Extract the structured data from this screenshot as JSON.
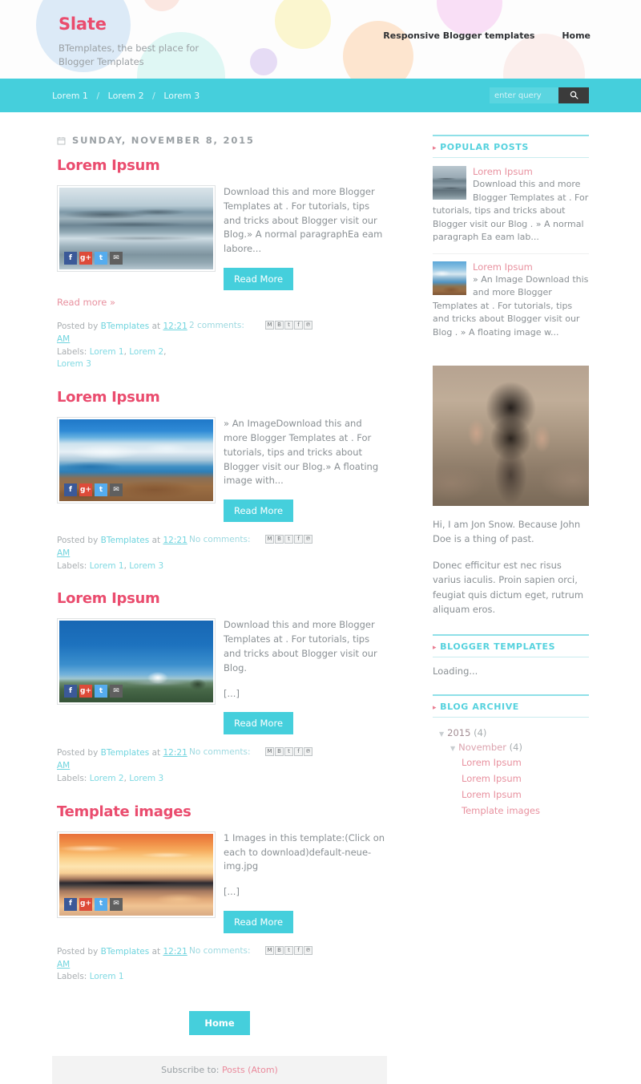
{
  "header": {
    "brand_title": "Slate",
    "brand_description": "BTemplates, the best place for Blogger Templates",
    "nav": [
      {
        "label": "Responsive Blogger templates"
      },
      {
        "label": "Home"
      }
    ]
  },
  "navbar": {
    "breadcrumb": [
      {
        "label": "Lorem 1"
      },
      {
        "label": "Lorem 2"
      },
      {
        "label": "Lorem 3"
      }
    ],
    "separator": "/",
    "search": {
      "placeholder": "enter query",
      "value": "",
      "button_icon": "search-icon"
    }
  },
  "main": {
    "date_header": "SUNDAY, NOVEMBER 8, 2015",
    "date_icon": "calendar-icon",
    "read_more_button": "Read More",
    "read_more_link": "Read more »",
    "share_buttons": [
      {
        "name": "facebook",
        "glyph": "f",
        "color": "#3b5998"
      },
      {
        "name": "google-plus",
        "glyph": "g+",
        "color": "#dd4b39"
      },
      {
        "name": "twitter",
        "glyph": "t",
        "color": "#55acee"
      },
      {
        "name": "email",
        "glyph": "✉",
        "color": "#5f5f5f"
      }
    ],
    "meta_share_icons": [
      {
        "name": "email-post-icon",
        "glyph": "M"
      },
      {
        "name": "blog-this-icon",
        "glyph": "B"
      },
      {
        "name": "share-to-twitter-icon",
        "glyph": "t"
      },
      {
        "name": "share-to-facebook-icon",
        "glyph": "f"
      },
      {
        "name": "share-to-pinterest-icon",
        "glyph": "℗"
      }
    ],
    "posts": [
      {
        "title": "Lorem Ipsum",
        "image": "img-snow",
        "excerpt": "Download this and more Blogger Templates at . For tutorials, tips and tricks about Blogger visit our Blog.» A normal paragraphEa eam labore...",
        "extra": "",
        "has_read_more_link": true,
        "posted_by_prefix": "Posted by",
        "author": "BTemplates",
        "at": "at",
        "time": "12:21 AM",
        "comments": "2 comments:",
        "labels_prefix": "Labels:",
        "labels": [
          "Lorem 1",
          "Lorem 2",
          "Lorem 3"
        ]
      },
      {
        "title": "Lorem Ipsum",
        "image": "img-glacier",
        "excerpt": "» An ImageDownload this and more Blogger Templates at . For tutorials, tips and tricks about Blogger visit our Blog.» A floating image with...",
        "extra": "",
        "has_read_more_link": false,
        "posted_by_prefix": "Posted by",
        "author": "BTemplates",
        "at": "at",
        "time": "12:21 AM",
        "comments": "No comments:",
        "labels_prefix": "Labels:",
        "labels": [
          "Lorem 1",
          "Lorem 3"
        ]
      },
      {
        "title": "Lorem Ipsum",
        "image": "img-volcano",
        "excerpt": "Download this and more Blogger Templates at . For tutorials, tips and tricks about Blogger visit our Blog.",
        "extra": "[...]",
        "has_read_more_link": false,
        "posted_by_prefix": "Posted by",
        "author": "BTemplates",
        "at": "at",
        "time": "12:21 AM",
        "comments": "No comments:",
        "labels_prefix": "Labels:",
        "labels": [
          "Lorem 2",
          "Lorem 3"
        ]
      },
      {
        "title": "Template images",
        "image": "img-sunset",
        "excerpt": "1 Images in this template:(Click on each to download)default-neue-img.jpg",
        "extra": "[...]",
        "has_read_more_link": false,
        "posted_by_prefix": "Posted by",
        "author": "BTemplates",
        "at": "at",
        "time": "12:21 AM",
        "comments": "No comments:",
        "labels_prefix": "Labels:",
        "labels": [
          "Lorem 1"
        ]
      }
    ],
    "home_button": "Home",
    "subscribe_prefix": "Subscribe to:",
    "subscribe_link": "Posts (Atom)"
  },
  "sidebar": {
    "popular_posts": {
      "title": "POPULAR POSTS",
      "items": [
        {
          "title": "Lorem Ipsum",
          "image": "img-birds",
          "snippet": "Download this and more Blogger Templates at . For tutorials, tips and tricks about Blogger visit our Blog . » A normal paragraph Ea eam lab..."
        },
        {
          "title": "Lorem Ipsum",
          "image": "img-glacier-sm",
          "snippet": "» An Image Download this and more Blogger Templates at . For tutorials, tips and tricks about Blogger visit our Blog . » A floating image w..."
        }
      ]
    },
    "profile": {
      "image": "img-photographer",
      "paragraphs": [
        "Hi, I am Jon Snow. Because John Doe is a thing of past.",
        "Donec efficitur est nec risus varius iaculis. Proin sapien orci, feugiat quis dictum eget, rutrum aliquam eros."
      ]
    },
    "blogger_templates": {
      "title": "BLOGGER TEMPLATES",
      "loading": "Loading..."
    },
    "blog_archive": {
      "title": "BLOG ARCHIVE",
      "year": "2015",
      "year_count": "(4)",
      "month": "November",
      "month_count": "(4)",
      "posts": [
        {
          "label": "Lorem Ipsum"
        },
        {
          "label": "Lorem Ipsum"
        },
        {
          "label": "Lorem Ipsum"
        },
        {
          "label": "Template images"
        }
      ]
    }
  },
  "colors": {
    "accent_cyan": "#45cfdc",
    "accent_pink": "#ea4c6e",
    "link_pink": "#e8919f",
    "text_gray": "#8a9094"
  }
}
